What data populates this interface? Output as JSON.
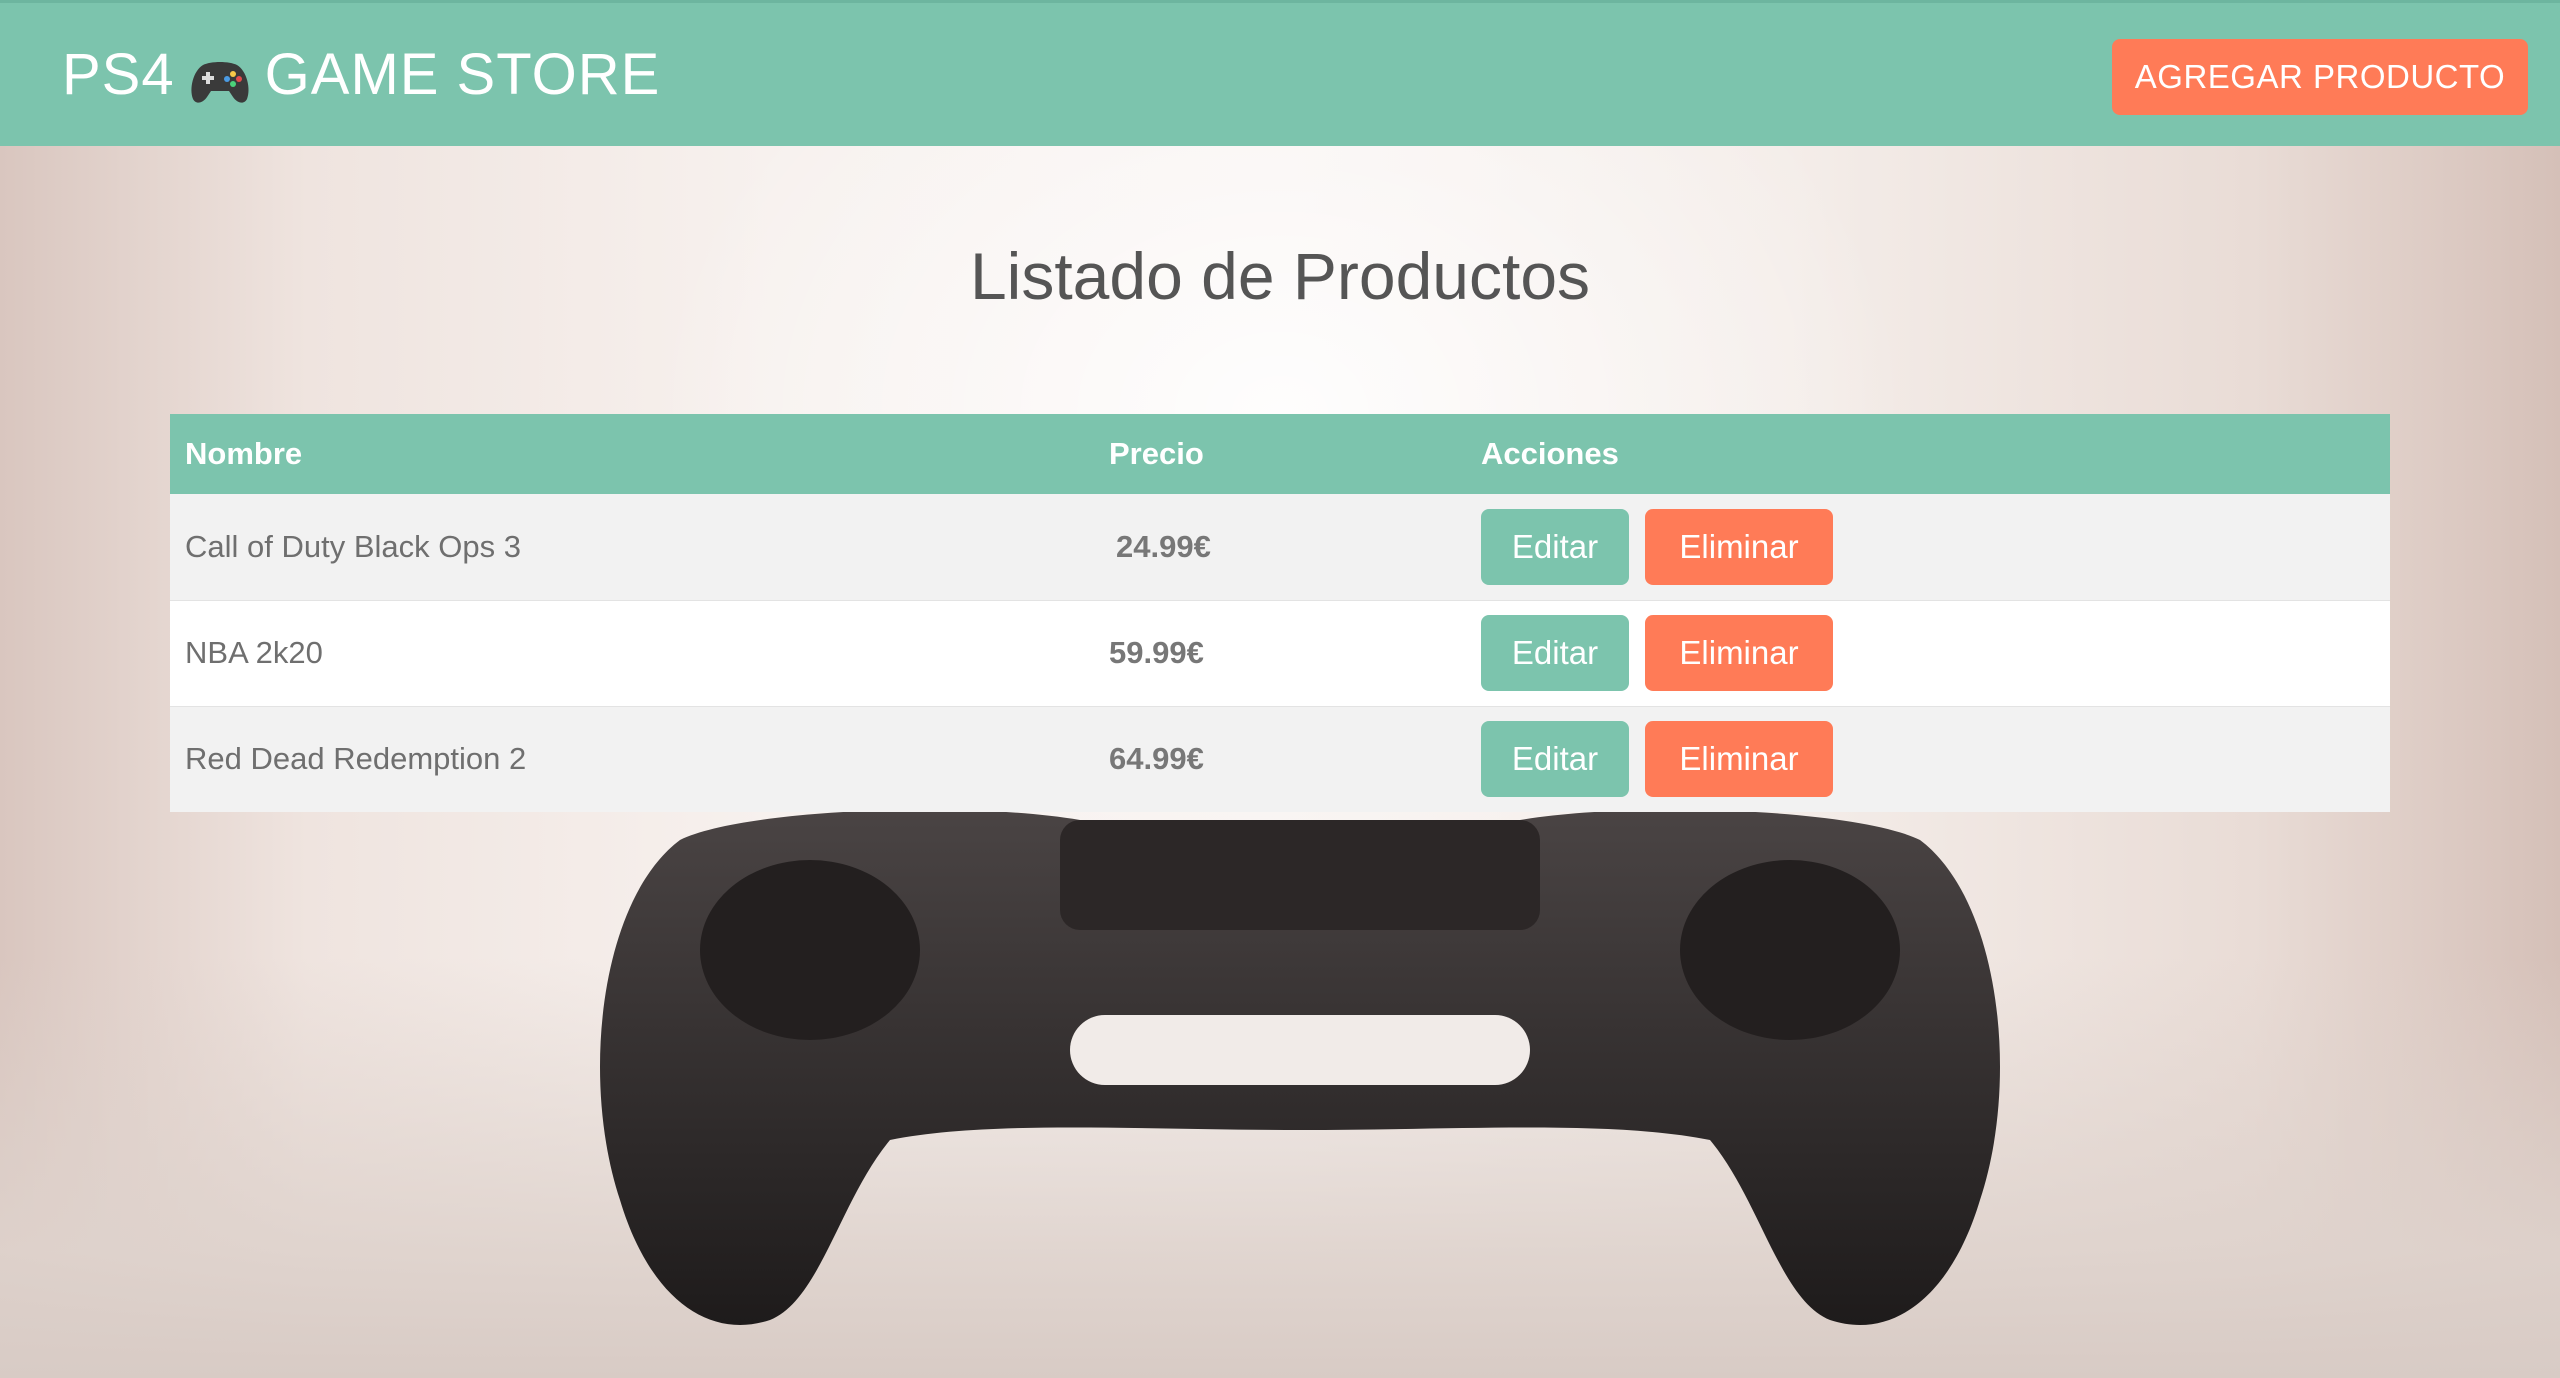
{
  "navbar": {
    "brand_prefix": "PS4",
    "brand_suffix": "GAME STORE",
    "brand_icon": "gamepad-icon",
    "add_button_label": "AGREGAR PRODUCTO"
  },
  "main": {
    "title": "Listado de Productos"
  },
  "table": {
    "headers": [
      "Nombre",
      "Precio",
      "Acciones"
    ],
    "rows": [
      {
        "name": "Call of Duty Black Ops 3",
        "price": "24.99€",
        "edit_label": "Editar",
        "delete_label": "Eliminar"
      },
      {
        "name": "NBA 2k20",
        "price": "59.99€",
        "edit_label": "Editar",
        "delete_label": "Eliminar"
      },
      {
        "name": "Red Dead Redemption 2",
        "price": "64.99€",
        "edit_label": "Editar",
        "delete_label": "Eliminar"
      }
    ]
  },
  "colors": {
    "primary": "#7cc4ad",
    "accent": "#ff7b57"
  }
}
